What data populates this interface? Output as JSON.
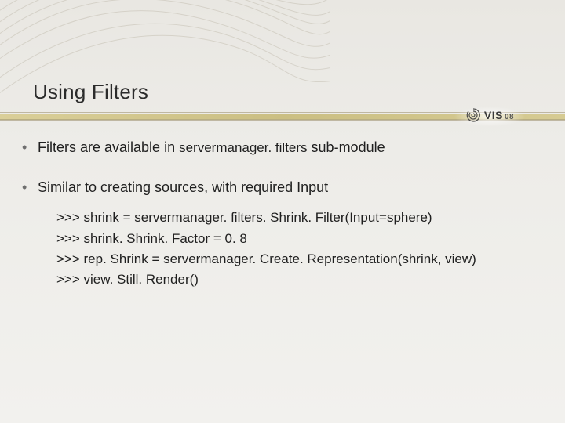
{
  "title": "Using Filters",
  "logo": {
    "text": "VIS",
    "year": "08"
  },
  "bullets": [
    {
      "pre": "Filters are available in ",
      "code": "servermanager. filters",
      "post": " sub-module"
    },
    {
      "pre": "Similar to creating sources, with required Input",
      "code": "",
      "post": ""
    }
  ],
  "code_prompt": ">>> ",
  "code_lines": [
    "shrink = servermanager. filters. Shrink. Filter(Input=sphere)",
    "shrink. Shrink. Factor = 0. 8",
    "rep. Shrink = servermanager. Create. Representation(shrink, view)",
    "view. Still. Render()"
  ]
}
